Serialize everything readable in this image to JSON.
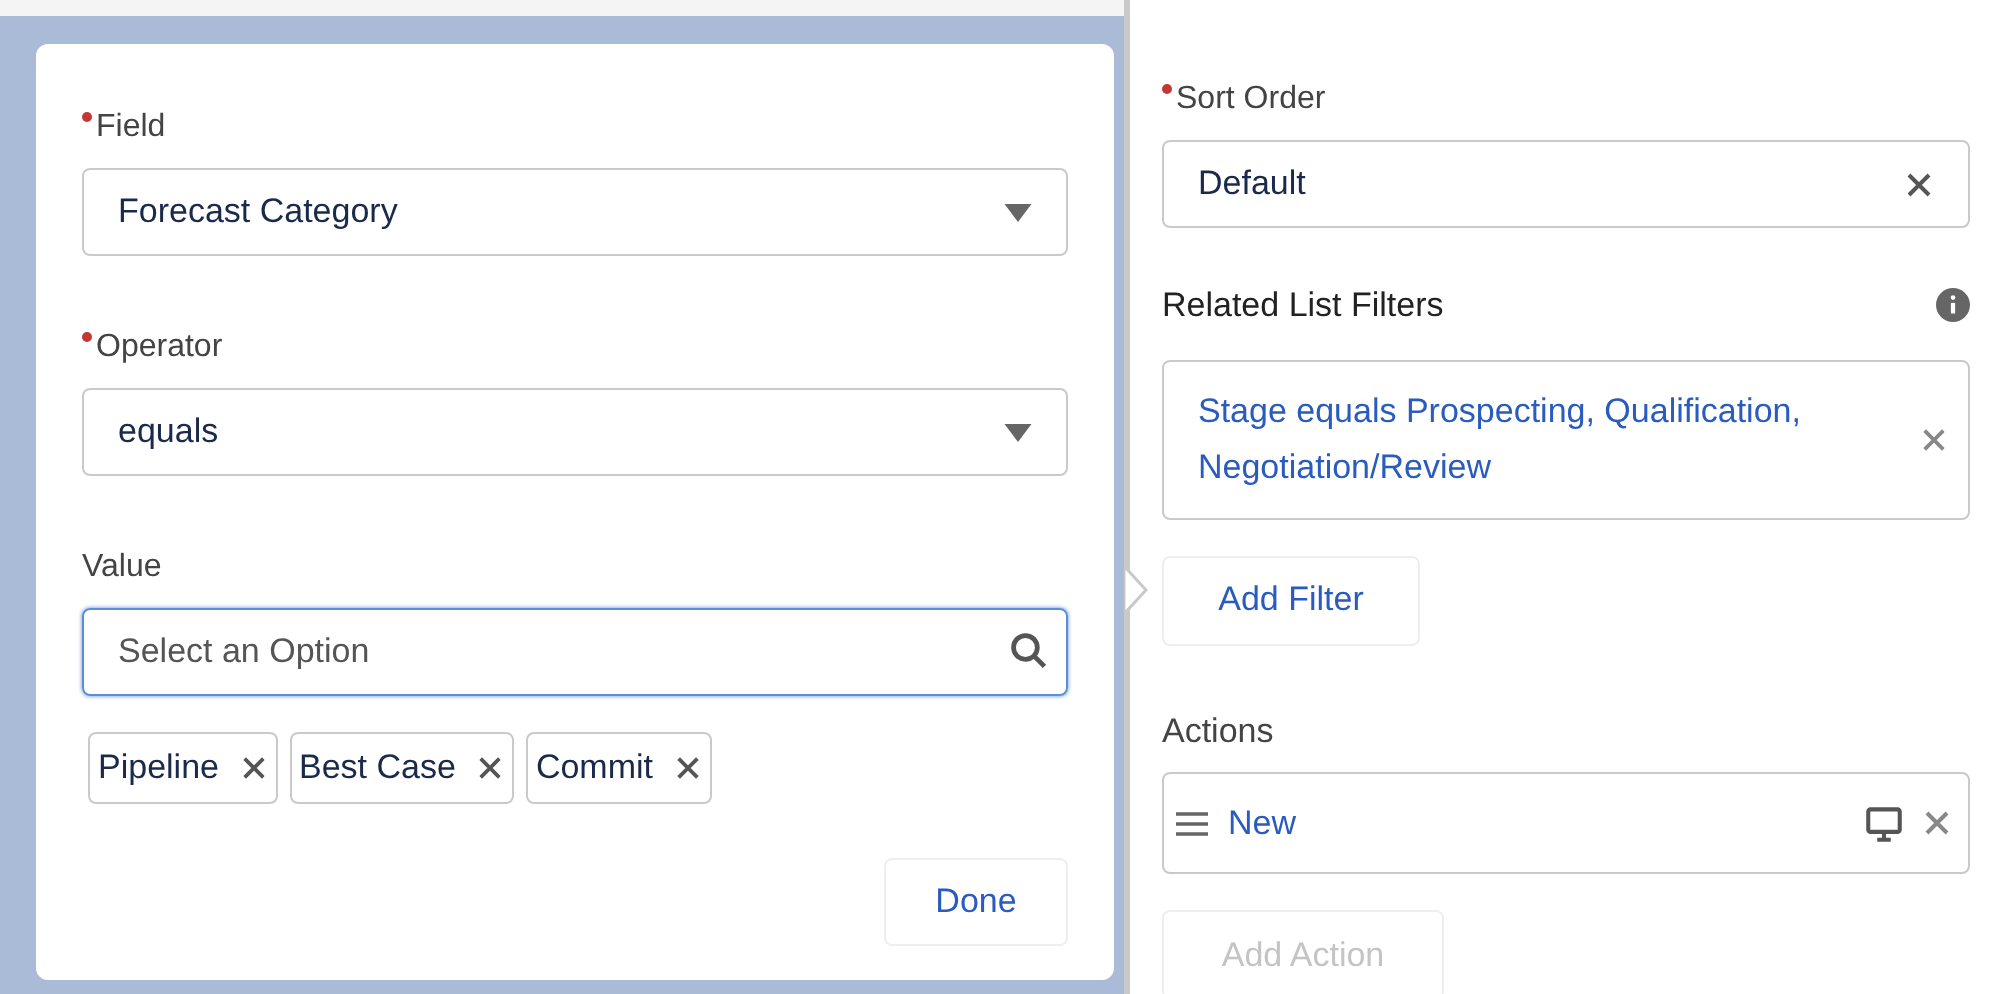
{
  "filter_popover": {
    "fields": [
      {
        "kind": "select",
        "label": "Field",
        "required": true,
        "value": "Forecast Category"
      },
      {
        "kind": "select",
        "label": "Operator",
        "required": true,
        "value": "equals"
      },
      {
        "kind": "search",
        "label": "Value",
        "required": false,
        "placeholder": "Select an Option",
        "focused": true
      }
    ],
    "pills": [
      "Pipeline",
      "Best Case",
      "Commit"
    ],
    "done_button": "Done"
  },
  "properties_panel": {
    "sort_order": {
      "label": "Sort Order",
      "required": true,
      "value": "Default"
    },
    "related_list_filters": {
      "label": "Related List Filters",
      "filter": "Stage equals Prospecting, Qualification, Negotiation/Review",
      "add_button": "Add Filter"
    },
    "actions": {
      "label": "Actions",
      "items": [
        {
          "label": "New"
        }
      ],
      "add_button": {
        "label": "Add Action",
        "disabled": true
      }
    }
  }
}
